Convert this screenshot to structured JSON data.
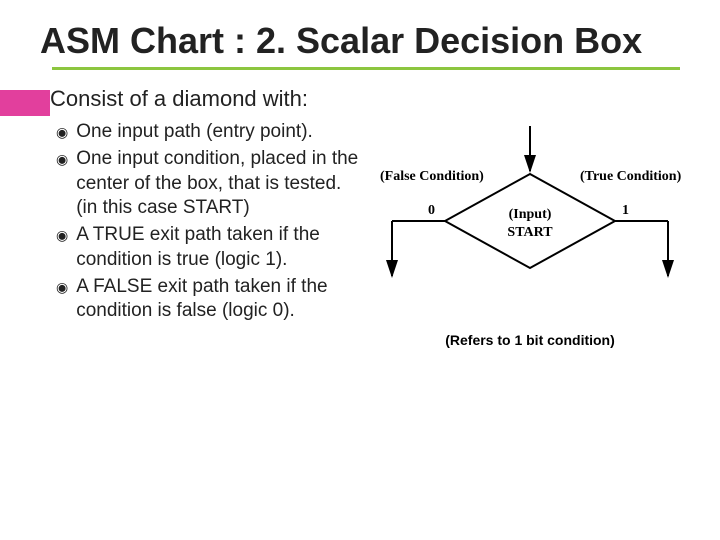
{
  "title": "ASM Chart : 2. Scalar Decision Box",
  "main_bullet": "Consist of a diamond with:",
  "sub_items": [
    "One input path (entry point).",
    "One input condition, placed in the center of the box, that is tested. (in this case START)",
    "A TRUE exit path taken if the condition is true (logic 1).",
    "A FALSE exit path taken if the condition is false (logic 0)."
  ],
  "figure": {
    "false_label": "(False Condition)",
    "true_label": "(True Condition)",
    "zero": "0",
    "one": "1",
    "input_label_top": "(Input)",
    "input_label_bottom": "START",
    "caption": "(Refers to 1 bit condition)"
  }
}
